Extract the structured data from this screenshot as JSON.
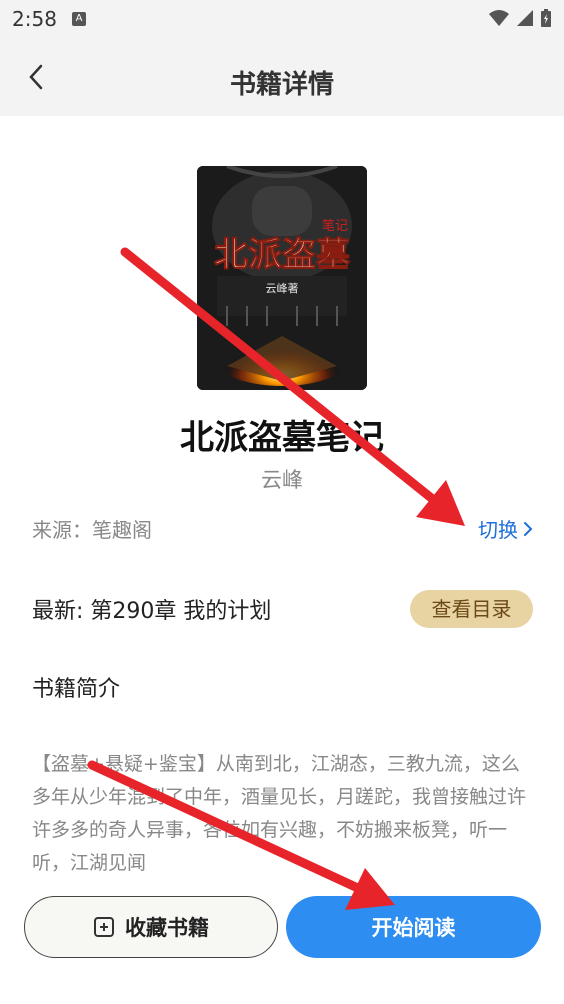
{
  "status": {
    "time": "2:58",
    "a_label": "A"
  },
  "header": {
    "title": "书籍详情",
    "back_icon": "chevron-left-icon"
  },
  "book": {
    "title": "北派盗墓笔记",
    "author": "云峰",
    "cover_text_main": "北派盗墓",
    "cover_text_tag": "笔记",
    "cover_text_author": "云峰著",
    "source_label": "来源：笔趣阁",
    "switch_label": "切换",
    "latest_label": "最新: 第290章 我的计划",
    "toc_button": "查看目录",
    "intro_heading": "书籍简介",
    "intro_text": "【盗墓+悬疑+鉴宝】从南到北，江湖态，三教九流，这么多年从少年混到了中年，酒量见长，月蹉跎，我曾接触过许许多多的奇人异事，各位如有兴趣，不妨搬来板凳，听一听，江湖见闻"
  },
  "actions": {
    "collect_label": "收藏书籍",
    "read_label": "开始阅读"
  },
  "colors": {
    "accent_blue": "#2e8df1",
    "link_blue": "#1e6fd9",
    "toc_bg": "#e8d3a3",
    "arrow_red": "#e8242b"
  }
}
